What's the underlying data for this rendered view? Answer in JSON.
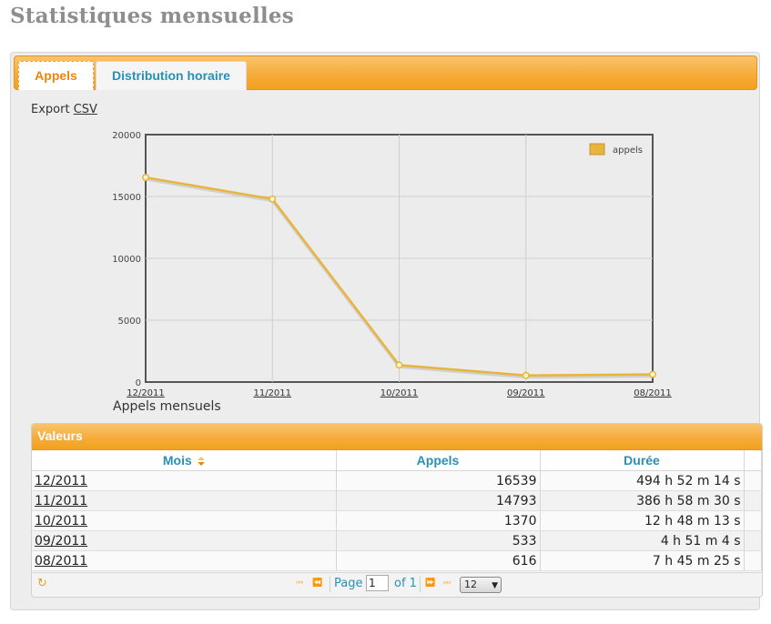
{
  "page": {
    "title": "Statistiques mensuelles"
  },
  "tabs": [
    {
      "label": "Appels",
      "active": true
    },
    {
      "label": "Distribution horaire",
      "active": false
    }
  ],
  "export": {
    "prefix": "Export",
    "link": "CSV"
  },
  "chart_data": {
    "type": "line",
    "title": "Appels mensuels",
    "categories": [
      "12/2011",
      "11/2011",
      "10/2011",
      "09/2011",
      "08/2011"
    ],
    "series": [
      {
        "name": "appels",
        "values": [
          16539,
          14793,
          1370,
          533,
          616
        ]
      }
    ],
    "ylim": [
      0,
      20000
    ],
    "yticks": [
      0,
      5000,
      10000,
      15000,
      20000
    ],
    "grid": true,
    "legend": "top-right",
    "color": "#e8b43c"
  },
  "grid": {
    "caption": "Valeurs",
    "columns": [
      "Mois",
      "Appels",
      "Durée"
    ],
    "rows": [
      {
        "mois": "12/2011",
        "appels": "16539",
        "duree": "494 h 52 m 14 s"
      },
      {
        "mois": "11/2011",
        "appels": "14793",
        "duree": "386 h 58 m 30 s"
      },
      {
        "mois": "10/2011",
        "appels": "1370",
        "duree": "12 h 48 m 13 s"
      },
      {
        "mois": "09/2011",
        "appels": "533",
        "duree": "4 h 51 m 4 s"
      },
      {
        "mois": "08/2011",
        "appels": "616",
        "duree": "7 h 45 m 25 s"
      }
    ]
  },
  "pager": {
    "page_label": "Page",
    "page_value": "1",
    "of_label": "of 1",
    "rows_per_page": "12"
  },
  "colors": {
    "accent": "#f6ac3a",
    "link": "#2a8fb4",
    "active_tab": "#e8870d"
  }
}
